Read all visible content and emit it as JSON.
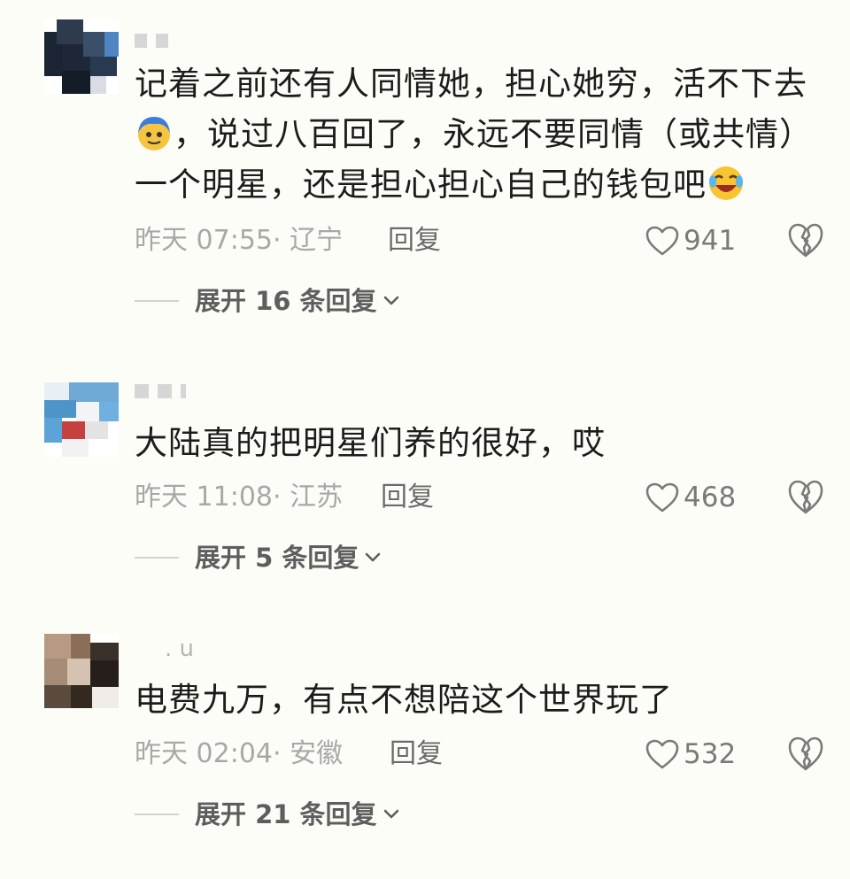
{
  "comments": [
    {
      "username": "",
      "text_lines": [
        "记着之前还有人同情她，担心她穷，活不下去",
        "，说过八百回了，永远不要同情（或共情）",
        "一个明星，还是担心担心自己的钱包吧"
      ],
      "time": "昨天 07:55",
      "location": "· 辽宁",
      "reply_label": "回复",
      "likes": "941",
      "expand_label": "展开 16 条回复"
    },
    {
      "username": "",
      "text_lines": [
        "大陆真的把明星们养的很好，哎"
      ],
      "time": "昨天 11:08",
      "location": "· 江苏",
      "reply_label": "回复",
      "likes": "468",
      "expand_label": "展开 5 条回复"
    },
    {
      "username": ". u",
      "text_lines": [
        "电费九万，有点不想陪这个世界玩了"
      ],
      "time": "昨天 02:04",
      "location": "· 安徽",
      "reply_label": "回复",
      "likes": "532",
      "expand_label": "展开 21 条回复"
    }
  ],
  "icons": {
    "like": "heart-outline-icon",
    "dislike": "broken-heart-icon",
    "expand": "chevron-down-icon",
    "emoji1": "blue-hair-face-emoji-icon",
    "emoji2": "laughing-crying-emoji-icon"
  },
  "colors": {
    "background": "#fdfdf8",
    "text": "#1c1c1c",
    "meta": "#a8a8a8",
    "expand": "#5e5e5e"
  }
}
